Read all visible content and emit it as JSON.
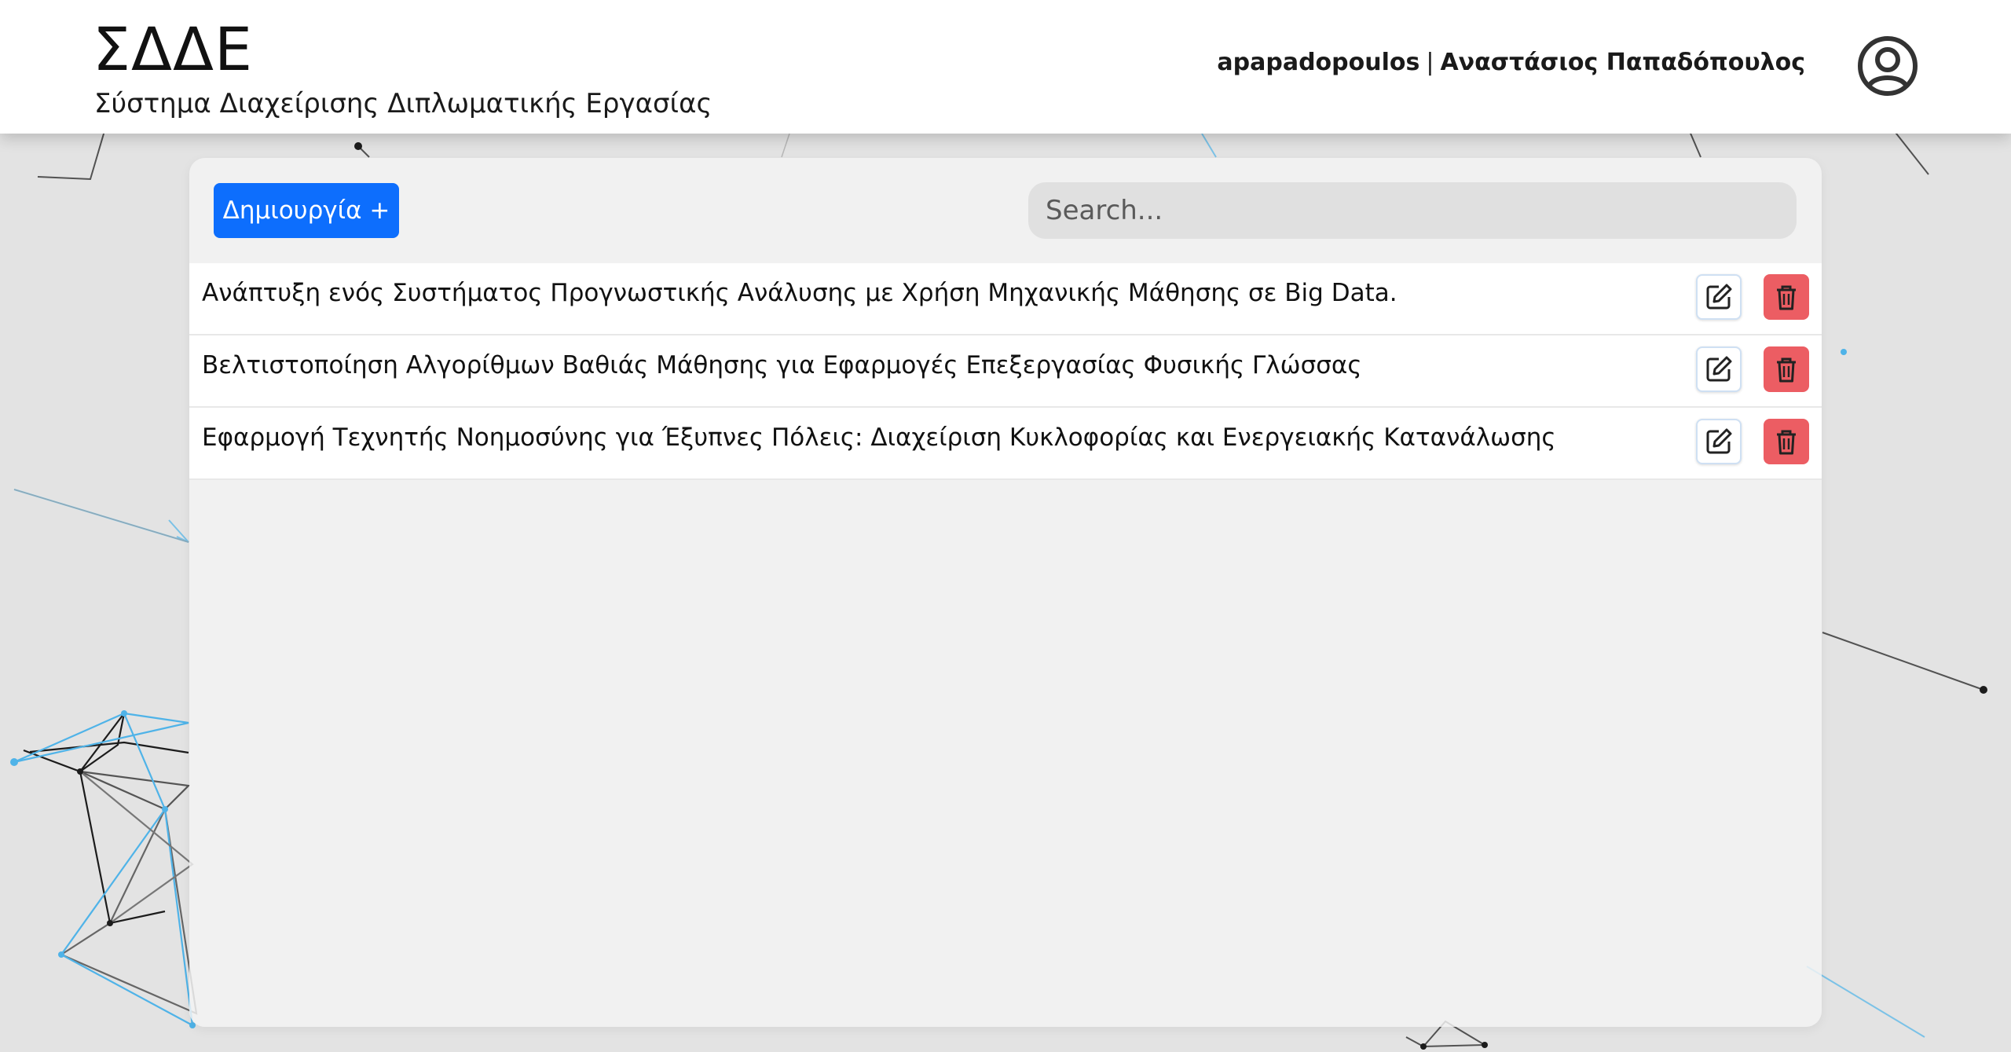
{
  "app": {
    "title": "ΣΔΔΕ",
    "subtitle": "Σύστημα Διαχείρισης Διπλωματικής Εργασίας"
  },
  "user": {
    "username": "apapadopoulos",
    "separator": "|",
    "full_name": "Αναστάσιος Παπαδόπουλος",
    "avatar_icon": "user-circle-icon"
  },
  "toolbar": {
    "create_label": "Δημιουργία +",
    "search_placeholder": "Search..."
  },
  "theses": [
    {
      "title": "Ανάπτυξη ενός Συστήματος Προγνωστικής Ανάλυσης με Χρήση Μηχανικής Μάθησης σε Big Data.",
      "edit_icon": "edit-icon",
      "delete_icon": "trash-icon"
    },
    {
      "title": "Βελτιστοποίηση Αλγορίθμων Βαθιάς Μάθησης για Εφαρμογές Επεξεργασίας Φυσικής Γλώσσας",
      "edit_icon": "edit-icon",
      "delete_icon": "trash-icon"
    },
    {
      "title": "Εφαρμογή Τεχνητής Νοημοσύνης για Έξυπνες Πόλεις: Διαχείριση Κυκλοφορίας και Ενεργειακής Κατανάλωσης",
      "edit_icon": "edit-icon",
      "delete_icon": "trash-icon"
    }
  ],
  "colors": {
    "primary": "#0d6efd",
    "danger": "#ec5d63",
    "background": "#e3e3e3",
    "network_dark": "#222222",
    "network_blue": "#4fb3e8"
  }
}
